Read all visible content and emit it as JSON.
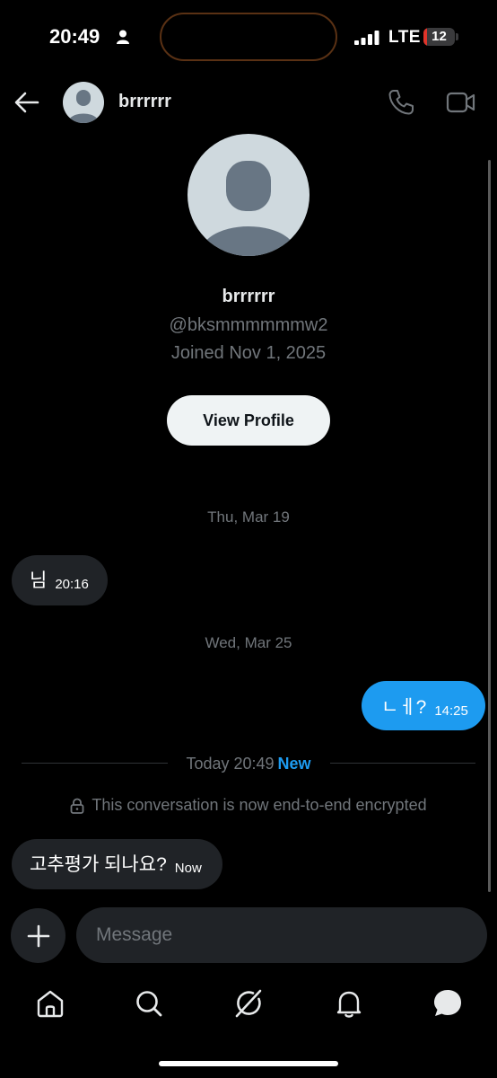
{
  "status_bar": {
    "time": "20:49",
    "network": "LTE",
    "battery": "12"
  },
  "header": {
    "name": "brrrrrr",
    "icons": [
      "back-arrow-icon",
      "phone-icon",
      "video-camera-icon"
    ]
  },
  "profile": {
    "name": "brrrrrr",
    "handle": "@bksmmmmmmw2",
    "joined": "Joined Nov 1, 2025",
    "view_profile_label": "View Profile"
  },
  "conversation": {
    "date_1": "Thu, Mar 19",
    "message_1": {
      "text": "님",
      "time": "20:16",
      "direction": "received"
    },
    "date_2": "Wed, Mar 25",
    "message_2": {
      "text": "ㄴㅔ?",
      "time": "14:25",
      "direction": "sent"
    },
    "today_label": "Today 20:49",
    "new_label": "New",
    "encryption_notice": "This conversation is now end-to-end encrypted",
    "message_3": {
      "text": "고추평가 되나요?",
      "time": "Now",
      "direction": "received"
    }
  },
  "composer": {
    "placeholder": "Message"
  },
  "tab_bar": {
    "items": [
      "home-icon",
      "search-icon",
      "grok-icon",
      "notifications-bell-icon",
      "messages-icon"
    ],
    "active": "messages-icon"
  },
  "colors": {
    "background": "#000000",
    "accent": "#1d9bf0",
    "bubble_received": "#202327",
    "muted_text": "#71767b"
  }
}
